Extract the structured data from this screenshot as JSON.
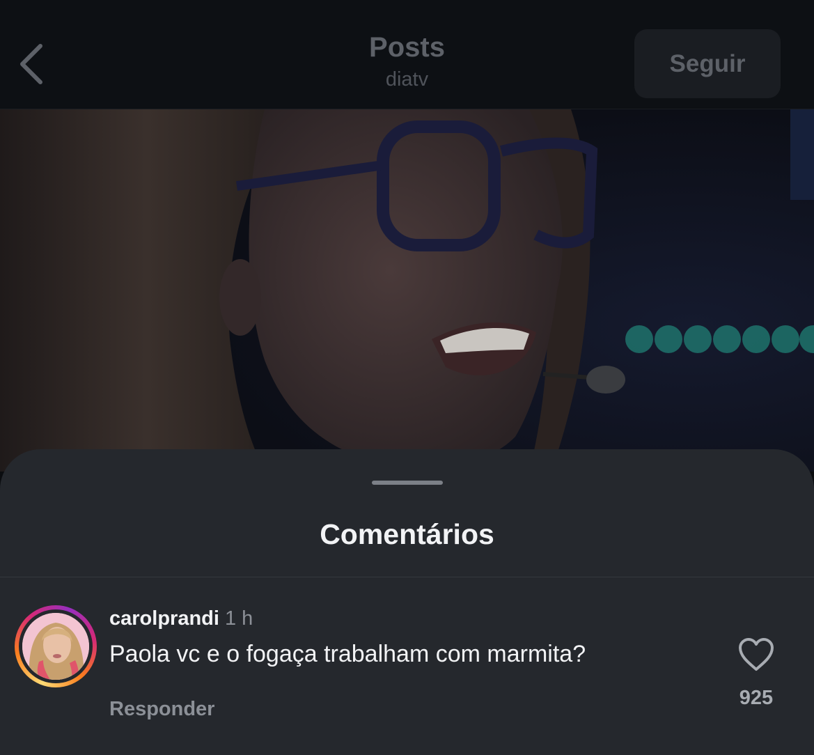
{
  "header": {
    "title": "Posts",
    "subtitle": "diatv",
    "follow_label": "Seguir"
  },
  "comments_sheet": {
    "title": "Comentários"
  },
  "comment": {
    "username": "carolprandi",
    "time": "1 h",
    "text": "Paola vc e o fogaça trabalham com marmita?",
    "reply_label": "Responder",
    "likes": "925"
  },
  "icons": {
    "back": "chevron-left-icon",
    "like": "heart-outline-icon"
  }
}
